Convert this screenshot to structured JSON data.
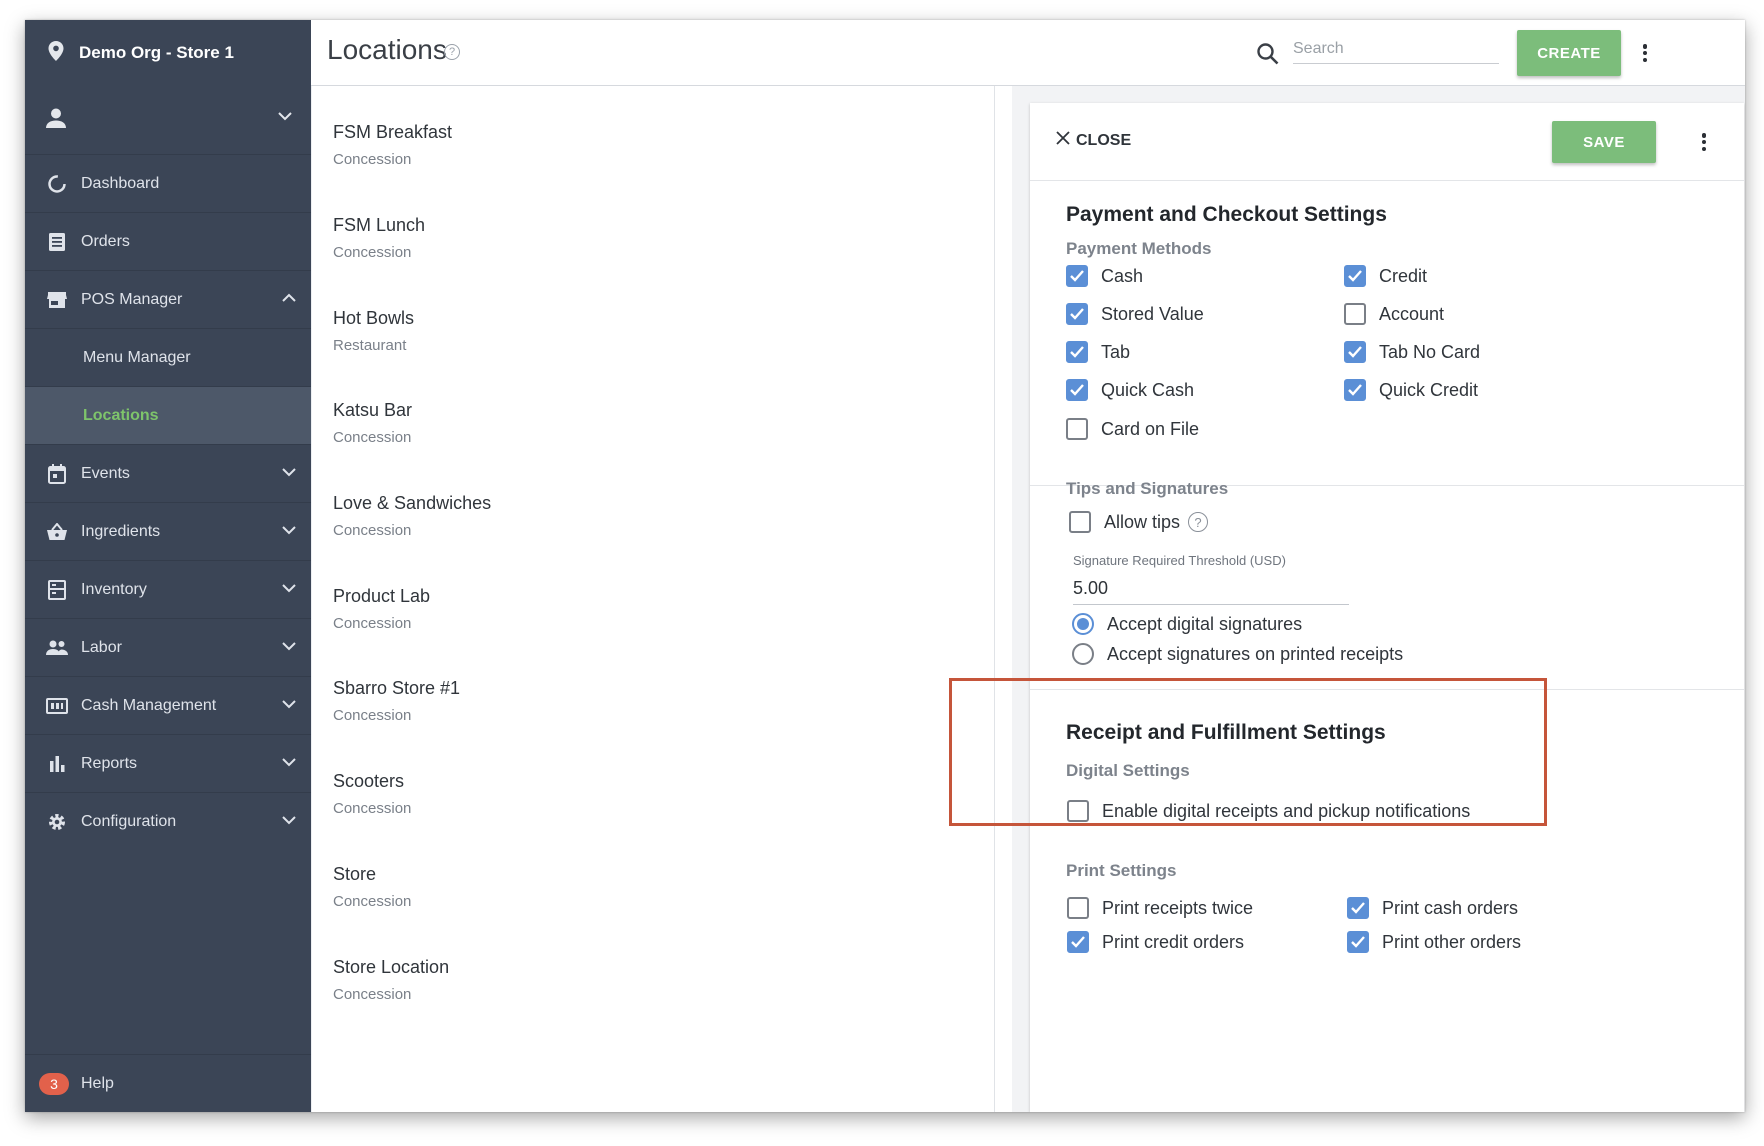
{
  "sidebar": {
    "org_name": "Demo Org - Store 1",
    "items": [
      {
        "label": "Dashboard",
        "icon": "dashboard-icon"
      },
      {
        "label": "Orders",
        "icon": "orders-icon"
      },
      {
        "label": "POS Manager",
        "icon": "store-icon",
        "expanded": true
      },
      {
        "label": "Menu Manager",
        "sub": true
      },
      {
        "label": "Locations",
        "sub": true,
        "active": true
      },
      {
        "label": "Events",
        "icon": "calendar-icon"
      },
      {
        "label": "Ingredients",
        "icon": "basket-icon"
      },
      {
        "label": "Inventory",
        "icon": "inventory-icon"
      },
      {
        "label": "Labor",
        "icon": "people-icon"
      },
      {
        "label": "Cash Management",
        "icon": "cash-icon"
      },
      {
        "label": "Reports",
        "icon": "bar-chart-icon"
      },
      {
        "label": "Configuration",
        "icon": "gear-icon"
      }
    ],
    "help": {
      "label": "Help",
      "badge": "3"
    }
  },
  "header": {
    "title": "Locations",
    "search_placeholder": "Search",
    "create_label": "CREATE"
  },
  "locations": [
    {
      "name": "FSM Breakfast",
      "type": "Concession"
    },
    {
      "name": "FSM Lunch",
      "type": "Concession"
    },
    {
      "name": "Hot Bowls",
      "type": "Restaurant"
    },
    {
      "name": "Katsu Bar",
      "type": "Concession"
    },
    {
      "name": "Love & Sandwiches",
      "type": "Concession"
    },
    {
      "name": "Product Lab",
      "type": "Concession"
    },
    {
      "name": "Sbarro Store #1",
      "type": "Concession"
    },
    {
      "name": "Scooters",
      "type": "Concession"
    },
    {
      "name": "Store",
      "type": "Concession"
    },
    {
      "name": "Store Location",
      "type": "Concession"
    }
  ],
  "panel": {
    "close_label": "CLOSE",
    "save_label": "SAVE",
    "payment": {
      "title": "Payment and Checkout Settings",
      "methods_title": "Payment Methods",
      "methods": [
        {
          "label": "Cash",
          "checked": true
        },
        {
          "label": "Credit",
          "checked": true
        },
        {
          "label": "Stored Value",
          "checked": true
        },
        {
          "label": "Account",
          "checked": false
        },
        {
          "label": "Tab",
          "checked": true
        },
        {
          "label": "Tab No Card",
          "checked": true
        },
        {
          "label": "Quick Cash",
          "checked": true
        },
        {
          "label": "Quick Credit",
          "checked": true
        },
        {
          "label": "Card on File",
          "checked": false
        }
      ],
      "tips_title": "Tips and Signatures",
      "allow_tips": {
        "label": "Allow tips",
        "checked": false
      },
      "threshold_label": "Signature Required Threshold (USD)",
      "threshold_value": "5.00",
      "signature_options": [
        {
          "label": "Accept digital signatures",
          "selected": true
        },
        {
          "label": "Accept signatures on printed receipts",
          "selected": false
        }
      ]
    },
    "receipt": {
      "title": "Receipt and Fulfillment Settings",
      "digital_title": "Digital Settings",
      "digital_option": {
        "label": "Enable digital receipts and pickup notifications",
        "checked": false
      },
      "print_title": "Print Settings",
      "print_options": [
        {
          "label": "Print receipts twice",
          "checked": false
        },
        {
          "label": "Print cash orders",
          "checked": true
        },
        {
          "label": "Print credit orders",
          "checked": true
        },
        {
          "label": "Print other orders",
          "checked": true
        }
      ]
    }
  },
  "colors": {
    "sidebar_bg": "#3b4556",
    "active_nav": "#7ec46b",
    "primary_green": "#7cbd7b",
    "checkbox_blue": "#5b8fd6",
    "highlight": "#c5553a",
    "badge": "#e2614b"
  }
}
